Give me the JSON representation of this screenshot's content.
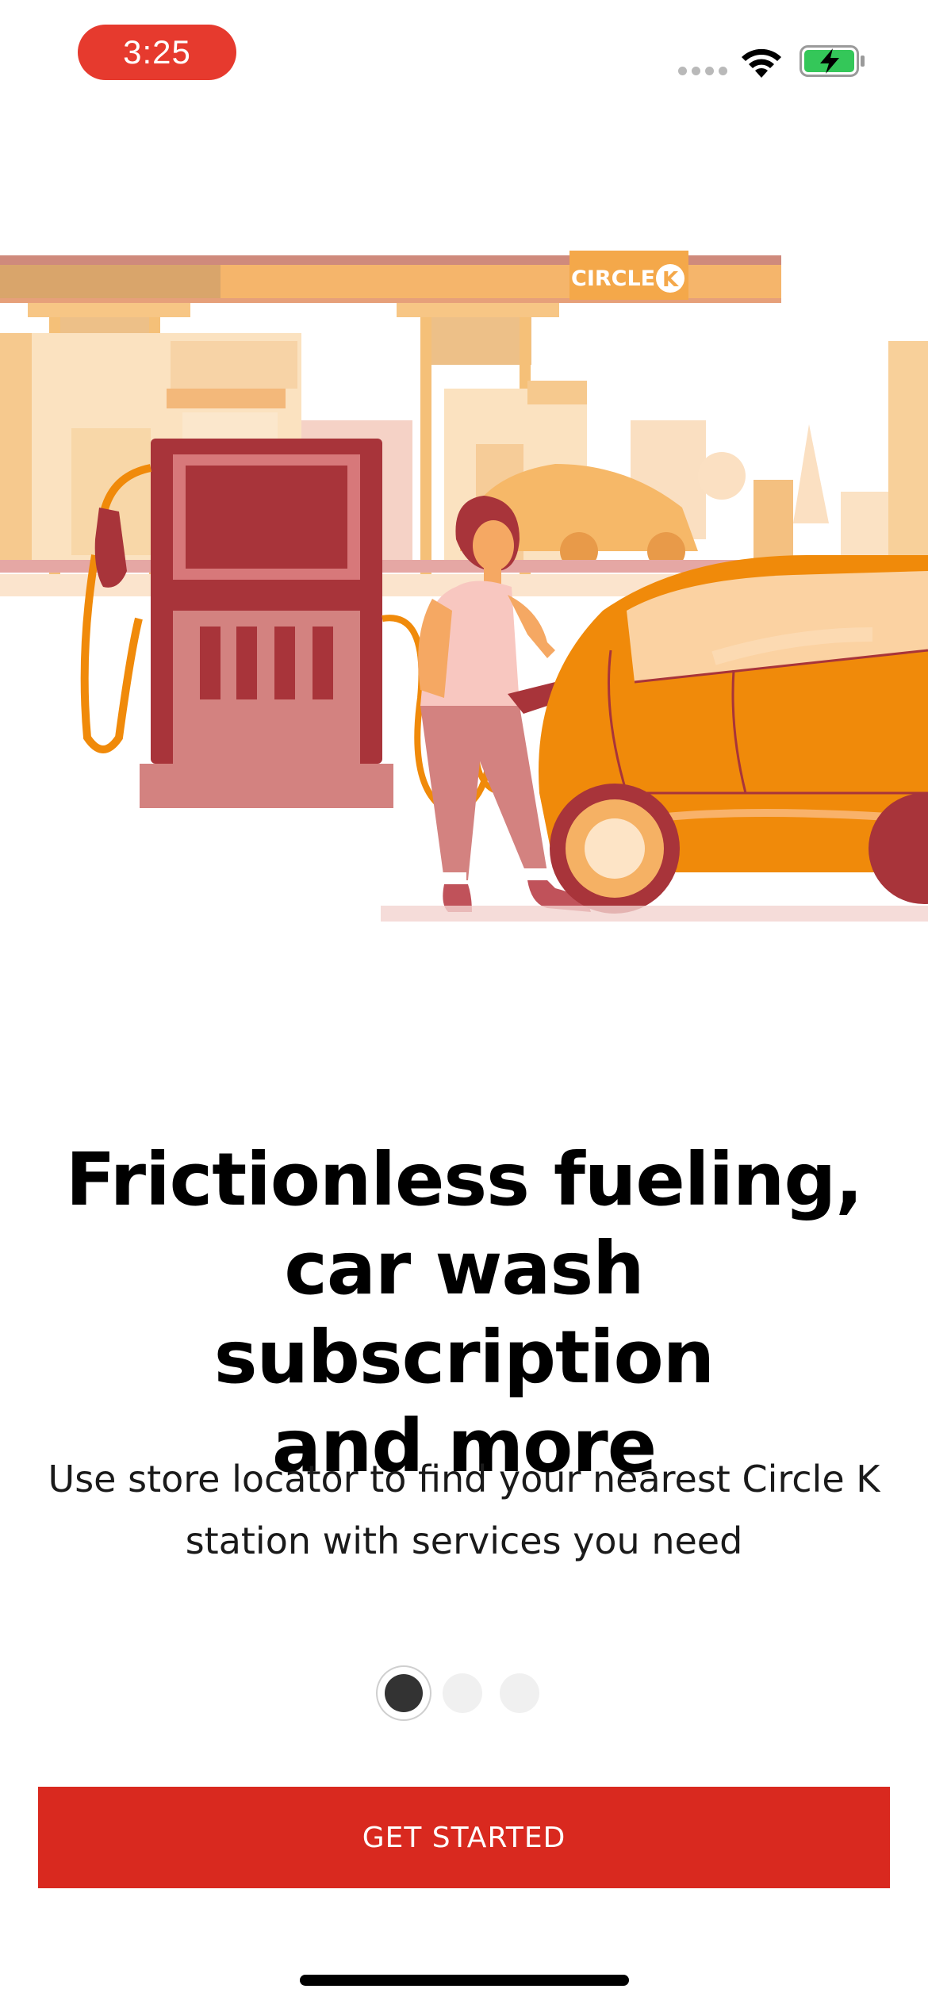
{
  "status_bar": {
    "time": "3:25",
    "signal_icon": "cellular-signal-icon",
    "wifi_icon": "wifi-icon",
    "battery_icon": "battery-charging-icon"
  },
  "illustration": {
    "logo_text": "CIRCLE",
    "logo_letter": "K"
  },
  "onboarding": {
    "headline_line1": "Frictionless fueling,",
    "headline_line2": "car wash subscription",
    "headline_line3": "and more",
    "subtext_line1": "Use store locator to find your nearest Circle K",
    "subtext_line2": "station with services you need",
    "pager": {
      "current_page": 1,
      "total_pages": 3
    },
    "cta_label": "GET STARTED"
  },
  "colors": {
    "brand_red": "#d9291f",
    "status_pill": "#e63a2e",
    "orange": "#f08a0a",
    "pump_red": "#a8343a"
  }
}
